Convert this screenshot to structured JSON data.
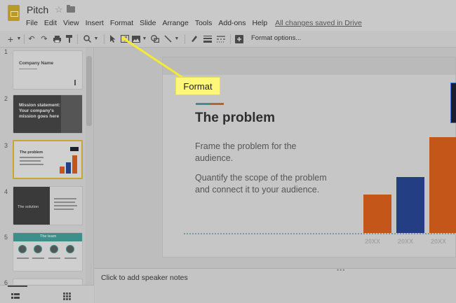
{
  "header": {
    "doc_title": "Pitch",
    "menu": [
      "File",
      "Edit",
      "View",
      "Insert",
      "Format",
      "Slide",
      "Arrange",
      "Tools",
      "Add-ons",
      "Help"
    ],
    "saved_status": "All changes saved in Drive"
  },
  "toolbar": {
    "format_options_label": "Format options..."
  },
  "filmstrip": {
    "slides": [
      {
        "num": "1",
        "title": "Company Name",
        "sub": ""
      },
      {
        "num": "2",
        "title": "Mission statement: Your company's mission goes here",
        "sub": ""
      },
      {
        "num": "3",
        "title": "The problem",
        "sub": ""
      },
      {
        "num": "4",
        "title": "The solution",
        "sub": ""
      },
      {
        "num": "5",
        "title": "The team",
        "sub": ""
      },
      {
        "num": "6",
        "title": "",
        "sub": ""
      }
    ]
  },
  "slide": {
    "title": "The problem",
    "body1": "Frame the problem for the audience.",
    "body2": "Quantify the scope of the problem and connect it to your audience.",
    "x_labels": [
      "20XX",
      "20XX",
      "20XX"
    ]
  },
  "chart_data": {
    "type": "bar",
    "categories": [
      "20XX",
      "20XX",
      "20XX"
    ],
    "values": [
      1,
      1.45,
      2.5
    ],
    "colors": [
      "#c4561a",
      "#233e82",
      "#c4561a"
    ]
  },
  "notes": {
    "placeholder": "Click to add speaker notes"
  },
  "callout": {
    "label": "Format",
    "color": "#fff77a"
  },
  "colors": {
    "accent_teal": "#3d8f8a",
    "accent_orange": "#c4561a",
    "accent_navy": "#233e82",
    "selection_gold": "#c8a431"
  }
}
